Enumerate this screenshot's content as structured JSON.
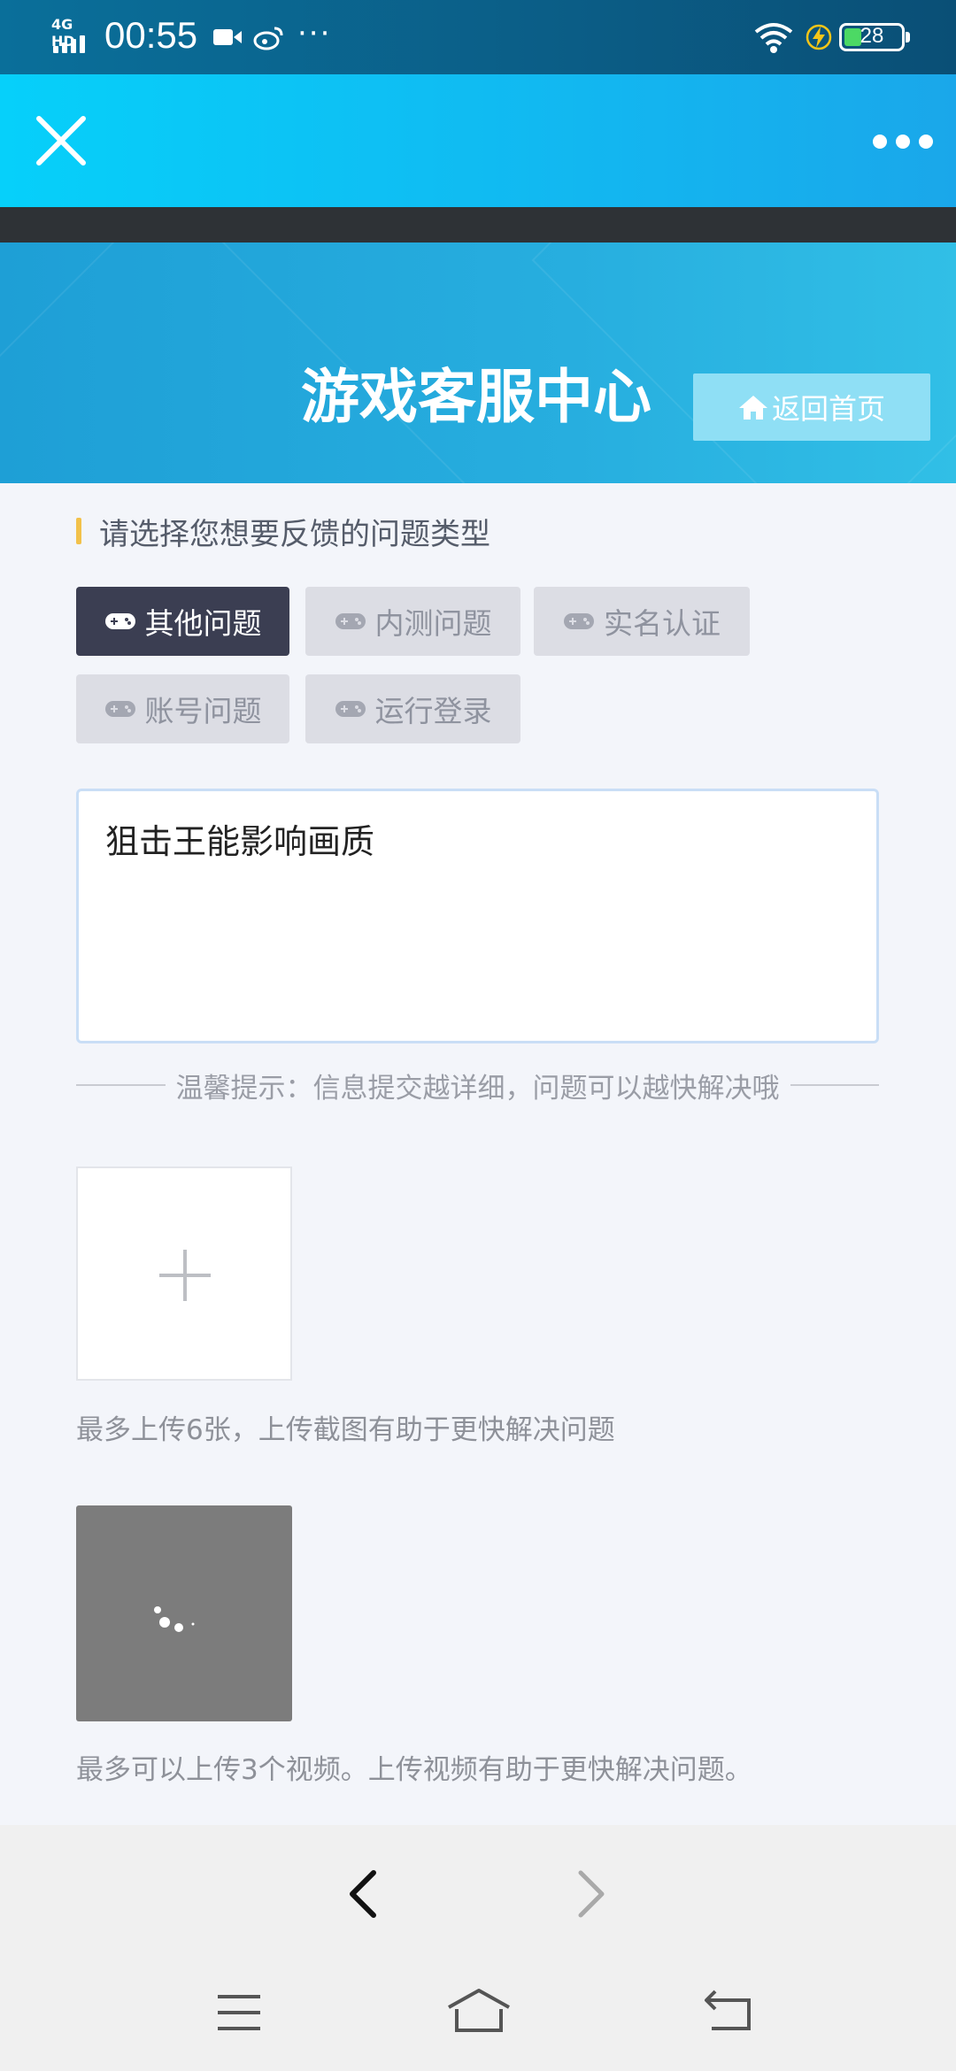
{
  "status_bar": {
    "network": "4G HD",
    "time": "00:55",
    "more": "···",
    "battery": "28"
  },
  "app_bar": {
    "close_icon": "close-icon",
    "more_icon": "more-dots-icon"
  },
  "banner": {
    "title": "游戏客服中心",
    "home_button": "返回首页"
  },
  "form": {
    "section_title": "请选择您想要反馈的问题类型",
    "categories": [
      {
        "label": "其他问题",
        "selected": true
      },
      {
        "label": "内测问题",
        "selected": false
      },
      {
        "label": "实名认证",
        "selected": false
      },
      {
        "label": "账号问题",
        "selected": false
      },
      {
        "label": "运行登录",
        "selected": false
      }
    ],
    "description": "狙击王能影响画质",
    "tip": "温馨提示：信息提交越详细，问题可以越快解决哦",
    "image_hint": "最多上传6张，上传截图有助于更快解决问题",
    "video_hint": "最多可以上传3个视频。上传视频有助于更快解决问题。"
  },
  "colors": {
    "accent": "#1aa7ea",
    "chip_active": "#3b3e52",
    "chip_inactive": "#dcdde4",
    "section_bar": "#f2c14a"
  }
}
